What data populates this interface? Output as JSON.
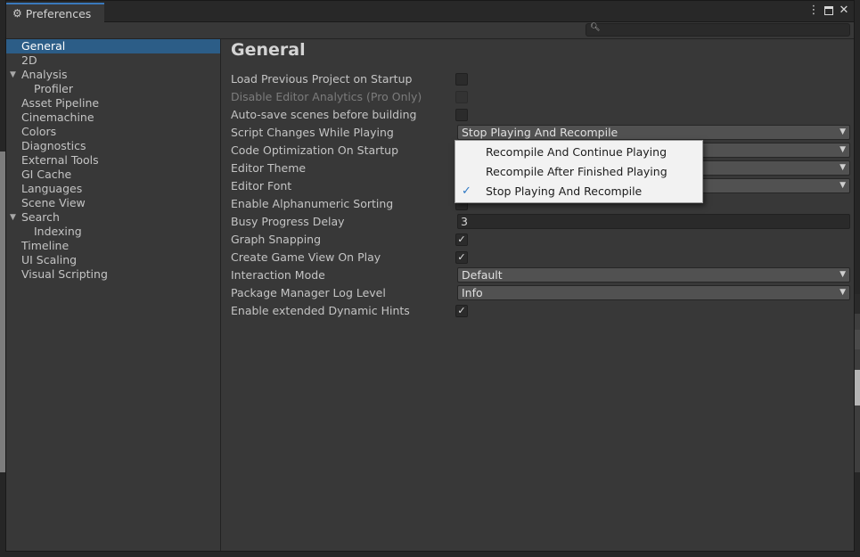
{
  "window": {
    "tab_label": "Preferences",
    "tab_icon": "gear-icon",
    "controls": {
      "more": "⋮",
      "maximize": "maximize-icon",
      "close": "✕"
    },
    "accent_color": "#3a79bb",
    "selection_color": "#2c5d87"
  },
  "search": {
    "value": "",
    "icon": "search-icon"
  },
  "sidebar": {
    "items": [
      {
        "label": "General",
        "selected": true
      },
      {
        "label": "2D"
      },
      {
        "label": "Analysis",
        "expanded": true
      },
      {
        "label": "Profiler",
        "indent": 1
      },
      {
        "label": "Asset Pipeline"
      },
      {
        "label": "Cinemachine"
      },
      {
        "label": "Colors"
      },
      {
        "label": "Diagnostics"
      },
      {
        "label": "External Tools"
      },
      {
        "label": "GI Cache"
      },
      {
        "label": "Languages"
      },
      {
        "label": "Scene View"
      },
      {
        "label": "Search",
        "expanded": true
      },
      {
        "label": "Indexing",
        "indent": 1
      },
      {
        "label": "Timeline"
      },
      {
        "label": "UI Scaling"
      },
      {
        "label": "Visual Scripting"
      }
    ]
  },
  "main": {
    "title": "General",
    "settings": [
      {
        "label": "Load Previous Project on Startup",
        "type": "checkbox",
        "checked": false
      },
      {
        "label": "Disable Editor Analytics (Pro Only)",
        "type": "checkbox",
        "checked": false,
        "disabled": true
      },
      {
        "label": "Auto-save scenes before building",
        "type": "checkbox",
        "checked": false
      },
      {
        "label": "Script Changes While Playing",
        "type": "dropdown",
        "value": "Stop Playing And Recompile"
      },
      {
        "label": "Code Optimization On Startup",
        "type": "dropdown",
        "value": ""
      },
      {
        "label": "Editor Theme",
        "type": "dropdown",
        "value": ""
      },
      {
        "label": "Editor Font",
        "type": "dropdown",
        "value": ""
      },
      {
        "label": "Enable Alphanumeric Sorting",
        "type": "checkbox",
        "checked": false
      },
      {
        "label": "Busy Progress Delay",
        "type": "text",
        "value": "3"
      },
      {
        "label": "Graph Snapping",
        "type": "checkbox",
        "checked": true
      },
      {
        "label": "Create Game View On Play",
        "type": "checkbox",
        "checked": true
      },
      {
        "label": "Interaction Mode",
        "type": "dropdown",
        "value": "Default"
      },
      {
        "label": "Package Manager Log Level",
        "type": "dropdown",
        "value": "Info"
      },
      {
        "label": "Enable extended Dynamic Hints",
        "type": "checkbox",
        "checked": true
      }
    ]
  },
  "popup": {
    "items": [
      {
        "label": "Recompile And Continue Playing",
        "checked": false
      },
      {
        "label": "Recompile After Finished Playing",
        "checked": false
      },
      {
        "label": "Stop Playing And Recompile",
        "checked": true
      }
    ]
  }
}
